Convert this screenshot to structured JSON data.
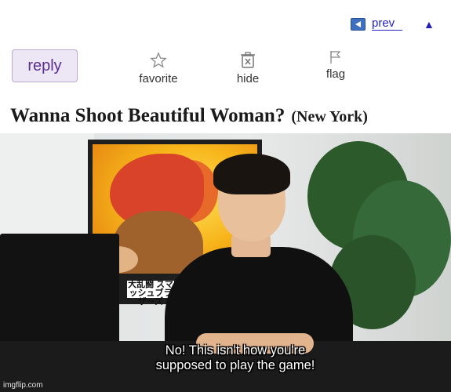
{
  "nav": {
    "prev_label": "prev",
    "up_glyph": "▲"
  },
  "actions": {
    "reply_label": "reply",
    "favorite_label": "favorite",
    "hide_label": "hide",
    "flag_label": "flag",
    "favorite_icon": "star-outline-icon",
    "hide_icon": "trash-x-icon",
    "flag_icon": "flag-outline-icon"
  },
  "post": {
    "title": "Wanna Shoot Beautiful Woman?",
    "location": "(New York)"
  },
  "meme": {
    "caption_line1": "No! This isn't how you're",
    "caption_line2": "supposed to play the game!",
    "poster_logo_text": "大乱闘 スマッシュブラザーズ",
    "poster_logo_x": "×",
    "watermark": "imgflip.com"
  },
  "colors": {
    "link": "#2323c8",
    "reply_bg": "#ece6f5",
    "reply_border": "#b9a9d3",
    "reply_text": "#5a2d91",
    "prev_icon_bg": "#3f6fbf"
  }
}
